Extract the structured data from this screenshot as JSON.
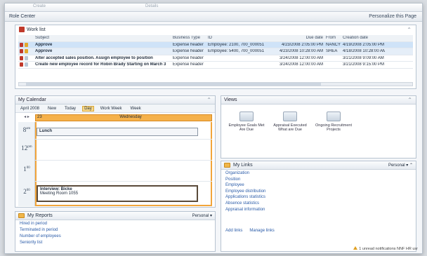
{
  "top_ghost": [
    "Create",
    "Details"
  ],
  "titlebar": {
    "title": "Role Center",
    "right": "Personalize this Page"
  },
  "worklist": {
    "title": "Work list",
    "columns": [
      "Subject",
      "Business Type",
      "ID",
      "Due date",
      "From",
      "Creation date"
    ],
    "rows": [
      {
        "subject": "Approve",
        "type": "Expense header",
        "id": "Employee: 2100, 700_000051",
        "due": "4/23/2008 2:05:00 PM",
        "from": "NANCY",
        "created": "4/19/2008 2:05:00 PM",
        "state": "sel"
      },
      {
        "subject": "Approve",
        "type": "Expense header",
        "id": "Employee: 5400, 700_000051",
        "due": "4/23/2008 10:28:00 AM",
        "from": "SHEA",
        "created": "4/18/2008 10:28:00 AM",
        "state": "sel2"
      },
      {
        "subject": "Alter accepted sales position. Assign employee to position",
        "type": "Expense header",
        "id": "",
        "due": "3/24/2008 12:00:00 AM",
        "from": "",
        "created": "3/21/2008 9:09:00 AM",
        "state": ""
      },
      {
        "subject": "Create new employee record for Robin Brady Starting on March 3",
        "type": "Expense header",
        "id": "",
        "due": "3/24/2008 12:00:00 AM",
        "from": "",
        "created": "3/21/2008 9:15:00 PM",
        "state": ""
      }
    ]
  },
  "calendar": {
    "title": "My Calendar",
    "toolbar": [
      "April 2008",
      "New",
      "Today",
      "Day",
      "Work Week",
      "Week"
    ],
    "day_num": "23",
    "day_name": "Wednesday",
    "times": [
      {
        "h": "8",
        "s": "am"
      },
      {
        "h": "12",
        "s": "pm"
      },
      {
        "h": "1",
        "s": "00"
      },
      {
        "h": "2",
        "s": "00"
      }
    ],
    "appt1": "Lunch",
    "appt2_title": "Interview: Bicke",
    "appt2_sub": "Meeting Room 1055"
  },
  "reports": {
    "title": "My Reports",
    "persona": "Personal",
    "items": [
      "Hired in period",
      "Terminated in period",
      "Number of employees",
      "Seniority list"
    ]
  },
  "views": {
    "title": "Views",
    "items": [
      "Employee Goals Met Are Due",
      "Appraisal Executed What are Due",
      "Ongoing Recruitment Projects"
    ]
  },
  "lists": {
    "title": "My Links",
    "persona": "Personal",
    "items": [
      "Organization",
      "Position",
      "Employee",
      "Employee distribution",
      "Applications statistics",
      "Absence statistics",
      "Appraisal information"
    ],
    "foot": [
      "Add links",
      "Manage links"
    ]
  },
  "status": "1 unread notifications  NNF  HR  usr"
}
